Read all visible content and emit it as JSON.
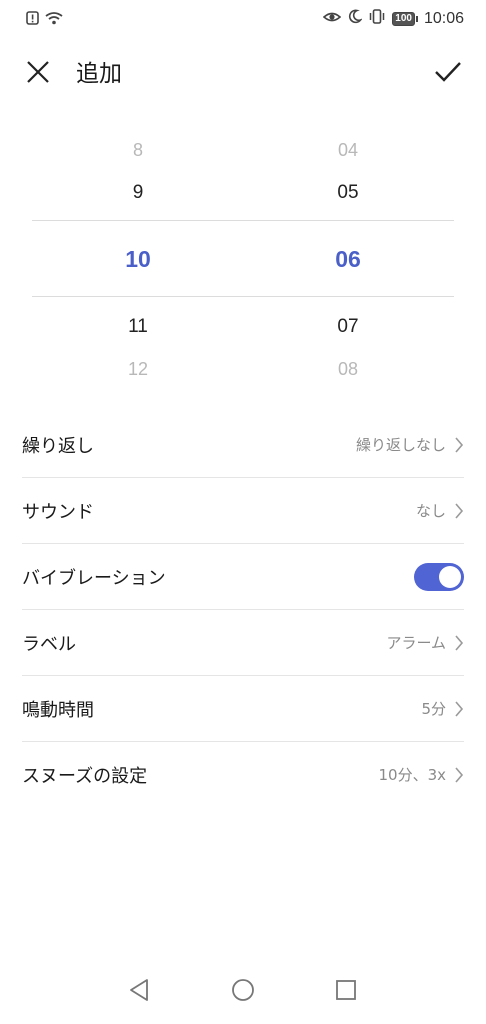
{
  "status_bar": {
    "time": "10:06",
    "battery_level": "100",
    "left_icons": [
      "alert-icon",
      "wifi-icon"
    ],
    "right_icons": [
      "eye-comfort-icon",
      "moon-icon",
      "vibrate-icon",
      "battery-icon"
    ]
  },
  "header": {
    "title": "追加",
    "close_icon": "close-icon",
    "confirm_icon": "check-icon"
  },
  "picker": {
    "hours": [
      "8",
      "9",
      "10",
      "11",
      "12"
    ],
    "minutes": [
      "04",
      "05",
      "06",
      "07",
      "08"
    ],
    "selected_hour": "10",
    "selected_minute": "06",
    "accent_color": "#4a5fc8"
  },
  "settings": [
    {
      "label": "繰り返し",
      "value": "繰り返しなし"
    },
    {
      "label": "サウンド",
      "value": "なし"
    },
    {
      "label": "バイブレーション",
      "toggle_on": true
    },
    {
      "label": "ラベル",
      "value": "アラーム"
    },
    {
      "label": "鳴動時間",
      "value": "5分"
    },
    {
      "label": "スヌーズの設定",
      "value": "10分、3x"
    }
  ],
  "nav_bar": {
    "icons": [
      "back-icon",
      "home-icon",
      "recents-icon"
    ]
  }
}
